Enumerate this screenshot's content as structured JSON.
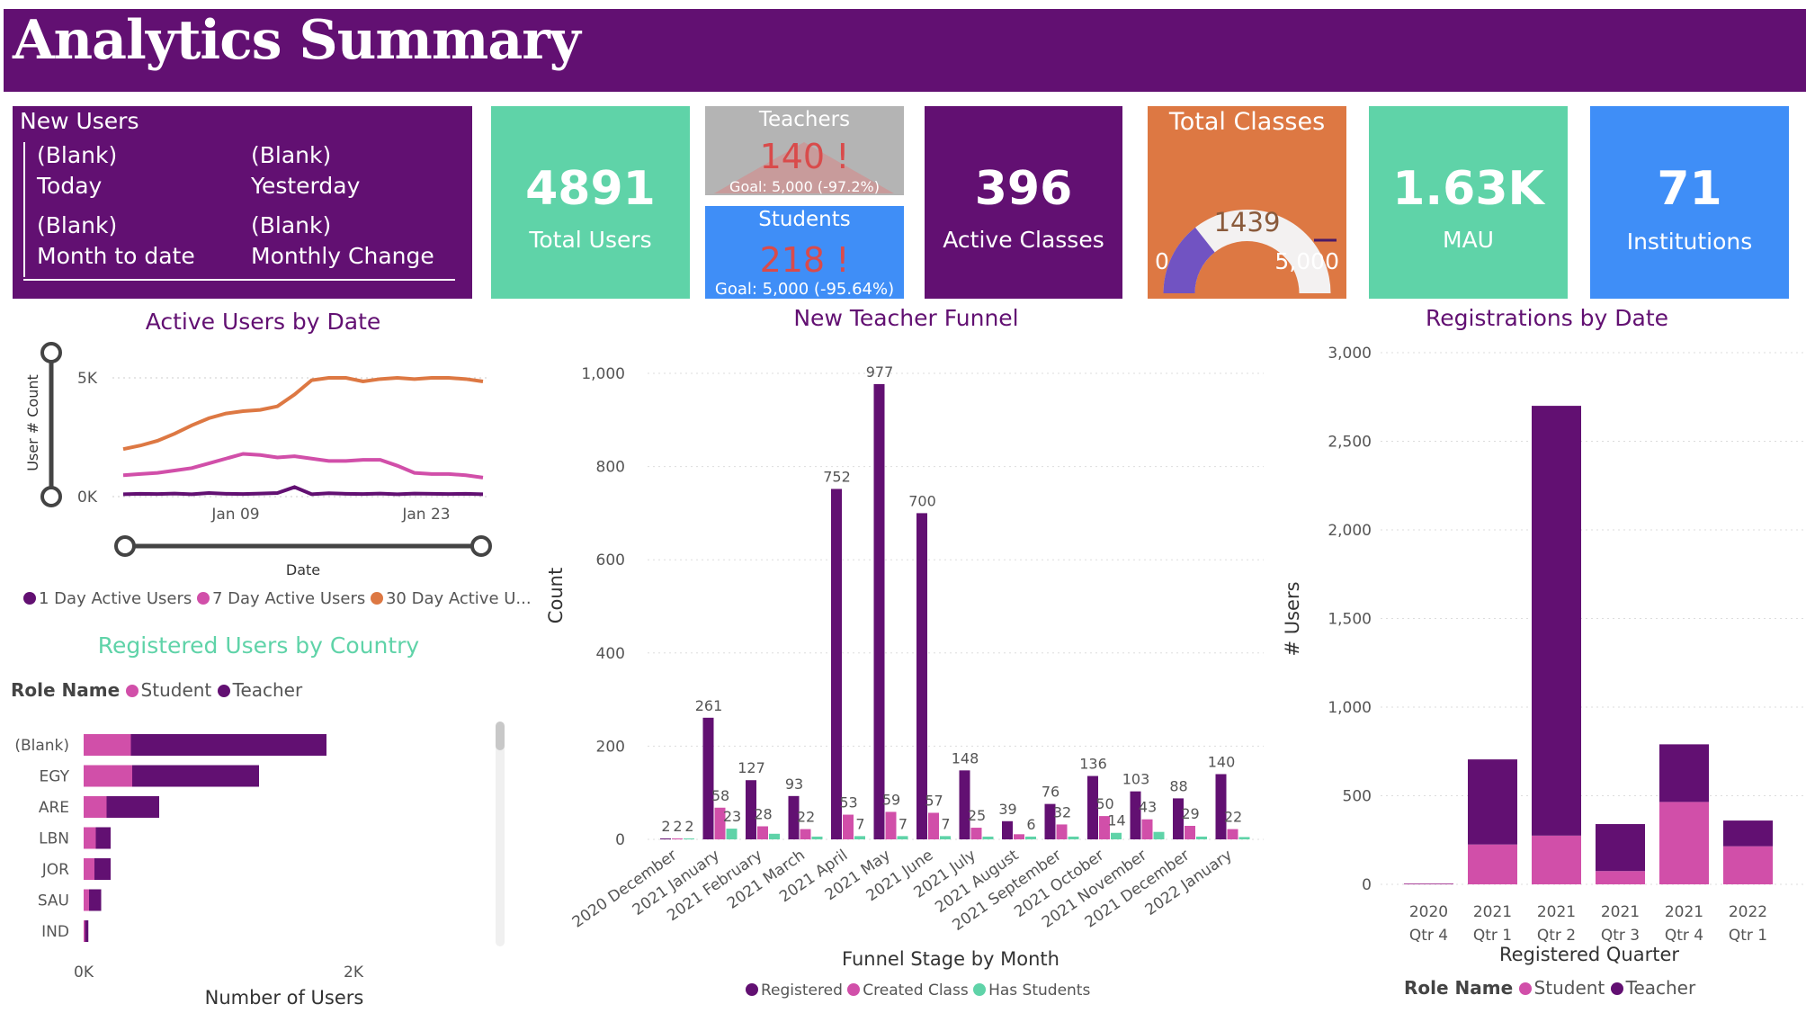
{
  "header": {
    "title": "Analytics Summary"
  },
  "new_users": {
    "title": "New Users",
    "items": [
      {
        "value": "(Blank)",
        "label": "Today"
      },
      {
        "value": "(Blank)",
        "label": "Yesterday"
      },
      {
        "value": "(Blank)",
        "label": "Month to date"
      },
      {
        "value": "(Blank)",
        "label": "Monthly Change"
      }
    ]
  },
  "kpis": {
    "total_users": {
      "value": "4891",
      "label": "Total Users"
    },
    "teachers": {
      "title": "Teachers",
      "value": "140 !",
      "goal": "Goal: 5,000 (-97.2%)"
    },
    "students": {
      "title": "Students",
      "value": "218 !",
      "goal": "Goal: 5,000 (-95.64%)"
    },
    "active_classes": {
      "value": "396",
      "label": "Active Classes"
    },
    "total_classes": {
      "title": "Total Classes",
      "value": "1439",
      "min": "0",
      "max": "5,000",
      "fraction": 0.2878
    },
    "mau": {
      "value": "1.63K",
      "label": "MAU"
    },
    "institutions": {
      "value": "71",
      "label": "Institutions"
    }
  },
  "colors": {
    "purple": "#621072",
    "pink": "#d14fa9",
    "teal": "#5fd3a8",
    "orange": "#dd7843",
    "blue": "#3f8ef7",
    "gray_card": "#b4b4b4"
  },
  "active_users_chart": {
    "title": "Active Users by Date",
    "ylabel": "User # Count",
    "xlabel": "Date",
    "yticks": [
      "5K",
      "0K"
    ],
    "xticks": [
      "Jan 09",
      "Jan 23"
    ],
    "legend": [
      "1 Day Active Users",
      "7 Day Active Users",
      "30 Day Active U..."
    ]
  },
  "country_chart": {
    "title": "Registered Users by Country",
    "legend_title": "Role Name",
    "legend": [
      "Student",
      "Teacher"
    ],
    "xticks": [
      "0K",
      "2K"
    ],
    "xlabel": "Number of Users"
  },
  "funnel_chart": {
    "title": "New Teacher Funnel",
    "ylabel": "Count",
    "xlabel": "Funnel Stage by Month",
    "legend": [
      "Registered",
      "Created Class",
      "Has Students"
    ]
  },
  "registrations_chart": {
    "title": "Registrations by Date",
    "ylabel": "# Users",
    "xlabel": "Registered Quarter",
    "legend_title": "Role Name",
    "legend": [
      "Student",
      "Teacher"
    ]
  },
  "chart_data": [
    {
      "type": "line",
      "title": "Active Users by Date",
      "xlabel": "Date",
      "ylabel": "User # Count",
      "ylim": [
        0,
        5000
      ],
      "x_ticks": [
        "Jan 09",
        "Jan 23"
      ],
      "series": [
        {
          "name": "30 Day Active Users",
          "values": [
            2000,
            2150,
            2350,
            2650,
            3000,
            3300,
            3500,
            3600,
            3650,
            3800,
            4300,
            4900,
            5000,
            5000,
            4850,
            4950,
            5000,
            4950,
            5000,
            5000,
            4950,
            4850
          ]
        },
        {
          "name": "7 Day Active Users",
          "values": [
            900,
            950,
            1000,
            1100,
            1200,
            1400,
            1600,
            1800,
            1750,
            1650,
            1700,
            1600,
            1500,
            1500,
            1550,
            1550,
            1300,
            1000,
            950,
            950,
            900,
            800
          ]
        },
        {
          "name": "1 Day Active Users",
          "values": [
            100,
            120,
            110,
            130,
            100,
            150,
            120,
            110,
            130,
            150,
            400,
            100,
            140,
            120,
            110,
            130,
            100,
            130,
            120,
            110,
            120,
            100
          ]
        }
      ]
    },
    {
      "type": "bar",
      "title": "Registered Users by Country",
      "orientation": "horizontal",
      "stacked": true,
      "categories": [
        "(Blank)",
        "EGY",
        "ARE",
        "LBN",
        "JOR",
        "SAU",
        "IND"
      ],
      "xlim": [
        0,
        2000
      ],
      "series": [
        {
          "name": "Student",
          "values": [
            350,
            360,
            170,
            90,
            80,
            40,
            10
          ]
        },
        {
          "name": "Teacher",
          "values": [
            1450,
            940,
            390,
            110,
            120,
            90,
            25
          ]
        }
      ]
    },
    {
      "type": "bar",
      "title": "New Teacher Funnel",
      "xlabel": "Funnel Stage by Month",
      "ylabel": "Count",
      "ylim": [
        0,
        1000
      ],
      "yticks": [
        0,
        200,
        400,
        600,
        800,
        1000
      ],
      "categories": [
        "2020 December",
        "2021 January",
        "2021 February",
        "2021 March",
        "2021 April",
        "2021 May",
        "2021 June",
        "2021 July",
        "2021 August",
        "2021 September",
        "2021 October",
        "2021 November",
        "2021 December",
        "2022 January"
      ],
      "series": [
        {
          "name": "Registered",
          "values": [
            2,
            261,
            127,
            93,
            752,
            977,
            700,
            148,
            39,
            76,
            136,
            103,
            88,
            140
          ]
        },
        {
          "name": "Created Class",
          "values": [
            2,
            68,
            28,
            22,
            53,
            59,
            57,
            25,
            11,
            32,
            50,
            43,
            29,
            22
          ]
        },
        {
          "name": "Has Students",
          "values": [
            2,
            23,
            12,
            6,
            7,
            7,
            7,
            6,
            6,
            6,
            14,
            16,
            6,
            5
          ]
        }
      ],
      "data_labels": {
        "Registered": [
          "2",
          "261",
          "127",
          "93",
          "752",
          "977",
          "700",
          "148",
          "39",
          "76",
          "136",
          "103",
          "88",
          "140"
        ],
        "Created Class": [
          "2",
          "58",
          "28",
          "22",
          "53",
          "59",
          "57",
          "25",
          "",
          "32",
          "50",
          "43",
          "29",
          "22"
        ],
        "Has Students": [
          "2",
          "23",
          "",
          "",
          "7",
          "7",
          "7",
          "",
          "6",
          "",
          "14",
          "",
          "",
          ""
        ]
      }
    },
    {
      "type": "bar",
      "title": "Registrations by Date",
      "stacked": true,
      "xlabel": "Registered Quarter",
      "ylabel": "# Users",
      "ylim": [
        0,
        3000
      ],
      "yticks": [
        "0",
        "500",
        "1,000",
        "1,500",
        "2,000",
        "2,500",
        "3,000"
      ],
      "categories": [
        [
          "2020",
          "Qtr 4"
        ],
        [
          "2021",
          "Qtr 1"
        ],
        [
          "2021",
          "Qtr 2"
        ],
        [
          "2021",
          "Qtr 3"
        ],
        [
          "2021",
          "Qtr 4"
        ],
        [
          "2022",
          "Qtr 1"
        ]
      ],
      "series": [
        {
          "name": "Student",
          "values": [
            3,
            225,
            275,
            75,
            465,
            215
          ]
        },
        {
          "name": "Teacher",
          "values": [
            2,
            480,
            2425,
            265,
            325,
            145
          ]
        }
      ]
    }
  ]
}
